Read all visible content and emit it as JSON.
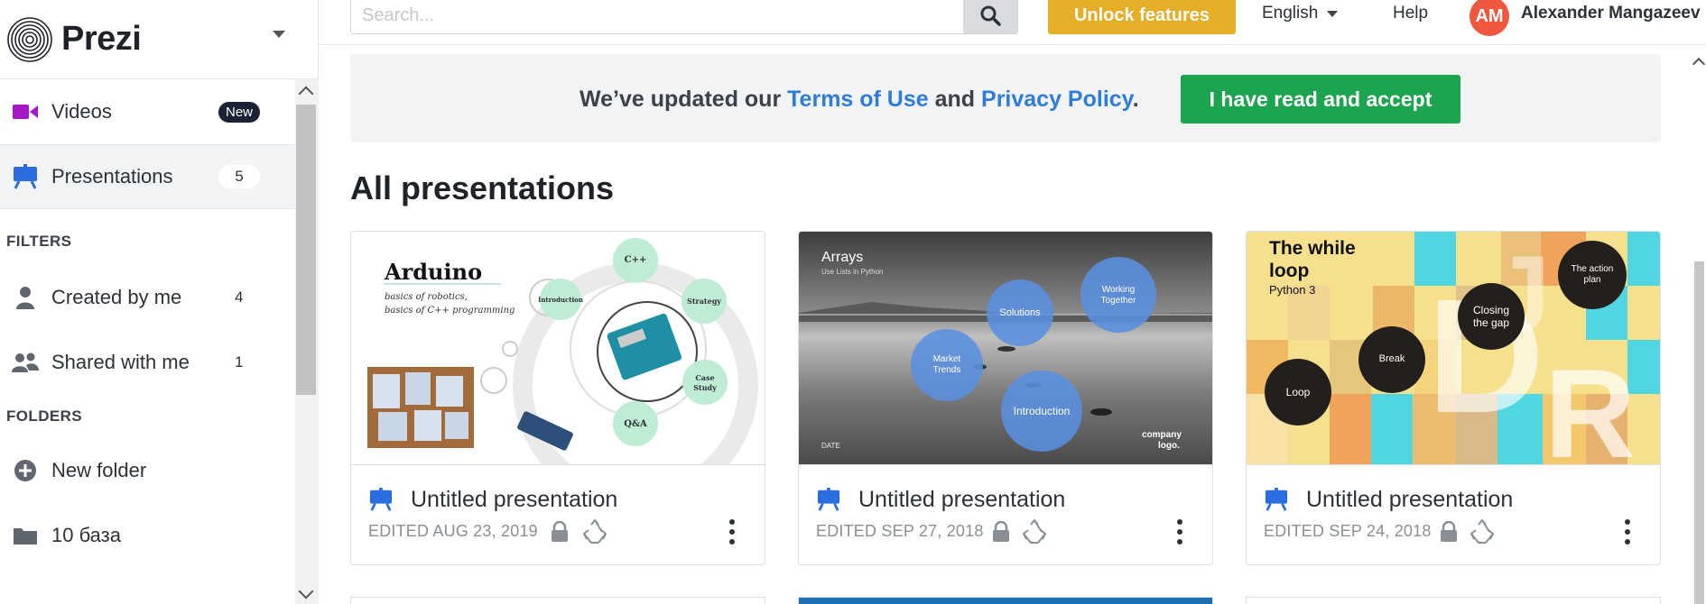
{
  "brand": {
    "name": "Prezi"
  },
  "sidebar": {
    "items": [
      {
        "label": "Videos",
        "badge": "New",
        "icon": "video-camera-icon"
      },
      {
        "label": "Presentations",
        "count": "5",
        "icon": "easel-icon"
      }
    ],
    "filters_heading": "FILTERS",
    "filters": [
      {
        "label": "Created by me",
        "count": "4",
        "icon": "person-icon"
      },
      {
        "label": "Shared with me",
        "count": "1",
        "icon": "people-icon"
      }
    ],
    "folders_heading": "FOLDERS",
    "folders": [
      {
        "label": "New folder",
        "icon": "plus-circle-icon"
      },
      {
        "label": "10 база",
        "icon": "folder-icon"
      }
    ]
  },
  "topbar": {
    "search_placeholder": "Search...",
    "unlock": "Unlock features",
    "language": "English",
    "help": "Help",
    "avatar_initials": "AM",
    "user_name": "Alexander Mangazeev"
  },
  "notice": {
    "prefix": "We’ve updated our ",
    "terms": "Terms of Use",
    "and": " and ",
    "privacy": "Privacy Policy",
    "suffix": ".",
    "accept": "I have read and accept"
  },
  "main": {
    "heading": "All presentations",
    "cards": [
      {
        "title": "Untitled presentation",
        "edited": "EDITED AUG 23, 2019",
        "thumb": {
          "title": "Arduino",
          "subtitle1": "basics of robotics,",
          "subtitle2": "basics of C++ programming",
          "bubbles": [
            "C++",
            "Strategy",
            "Case Study",
            "Q&A",
            "Introduction"
          ]
        }
      },
      {
        "title": "Untitled presentation",
        "edited": "EDITED SEP 27, 2018",
        "thumb": {
          "title": "Arrays",
          "subtitle": "Use Lists in Python",
          "bubbles": [
            "Solutions",
            "Working Together",
            "Market Trends",
            "Introduction"
          ],
          "date": "DATE",
          "logo1": "company",
          "logo2": "logo."
        }
      },
      {
        "title": "Untitled presentation",
        "edited": "EDITED SEP 24, 2018",
        "thumb": {
          "title1": "The while",
          "title2": "loop",
          "subtitle": "Python 3",
          "bubbles": [
            "The action plan",
            "Closing the gap",
            "Break",
            "Loop"
          ]
        }
      }
    ]
  },
  "colors": {
    "accent_blue": "#2f7dd6",
    "accept_green": "#1da44e",
    "unlock_gold": "#e6ad27",
    "avatar": "#f0573f"
  }
}
